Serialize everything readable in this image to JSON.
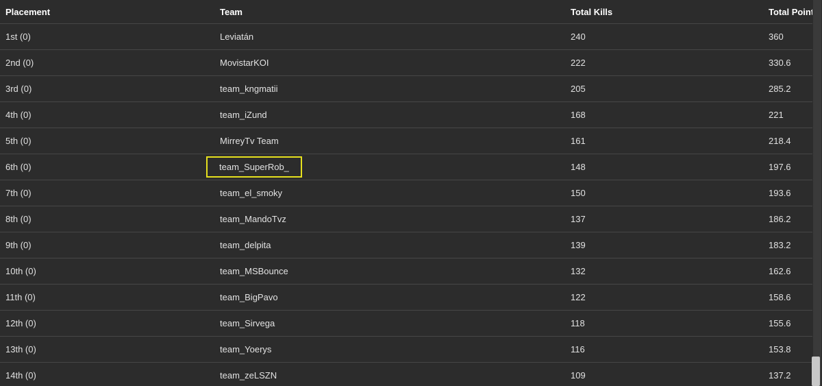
{
  "table": {
    "headers": {
      "placement": "Placement",
      "team": "Team",
      "kills": "Total Kills",
      "points": "Total Points"
    },
    "rows": [
      {
        "placement": "1st (0)",
        "team": "Leviatán",
        "kills": "240",
        "points": "360"
      },
      {
        "placement": "2nd (0)",
        "team": "MovistarKOI",
        "kills": "222",
        "points": "330.6"
      },
      {
        "placement": "3rd (0)",
        "team": "team_kngmatii",
        "kills": "205",
        "points": "285.2"
      },
      {
        "placement": "4th (0)",
        "team": "team_iZund",
        "kills": "168",
        "points": "221"
      },
      {
        "placement": "5th (0)",
        "team": "MirreyTv Team",
        "kills": "161",
        "points": "218.4"
      },
      {
        "placement": "6th (0)",
        "team": "team_SuperRob_",
        "kills": "148",
        "points": "197.6"
      },
      {
        "placement": "7th (0)",
        "team": "team_el_smoky",
        "kills": "150",
        "points": "193.6"
      },
      {
        "placement": "8th (0)",
        "team": "team_MandoTvz",
        "kills": "137",
        "points": "186.2"
      },
      {
        "placement": "9th (0)",
        "team": "team_delpita",
        "kills": "139",
        "points": "183.2"
      },
      {
        "placement": "10th (0)",
        "team": "team_MSBounce",
        "kills": "132",
        "points": "162.6"
      },
      {
        "placement": "11th (0)",
        "team": "team_BigPavo",
        "kills": "122",
        "points": "158.6"
      },
      {
        "placement": "12th (0)",
        "team": "team_Sirvega",
        "kills": "118",
        "points": "155.6"
      },
      {
        "placement": "13th (0)",
        "team": "team_Yoerys",
        "kills": "116",
        "points": "153.8"
      },
      {
        "placement": "14th (0)",
        "team": "team_zeLSZN",
        "kills": "109",
        "points": "137.2"
      }
    ],
    "highlighted_row_index": 5
  },
  "colors": {
    "background": "#2c2c2c",
    "highlight": "#e6e01e",
    "divider": "#474747"
  }
}
